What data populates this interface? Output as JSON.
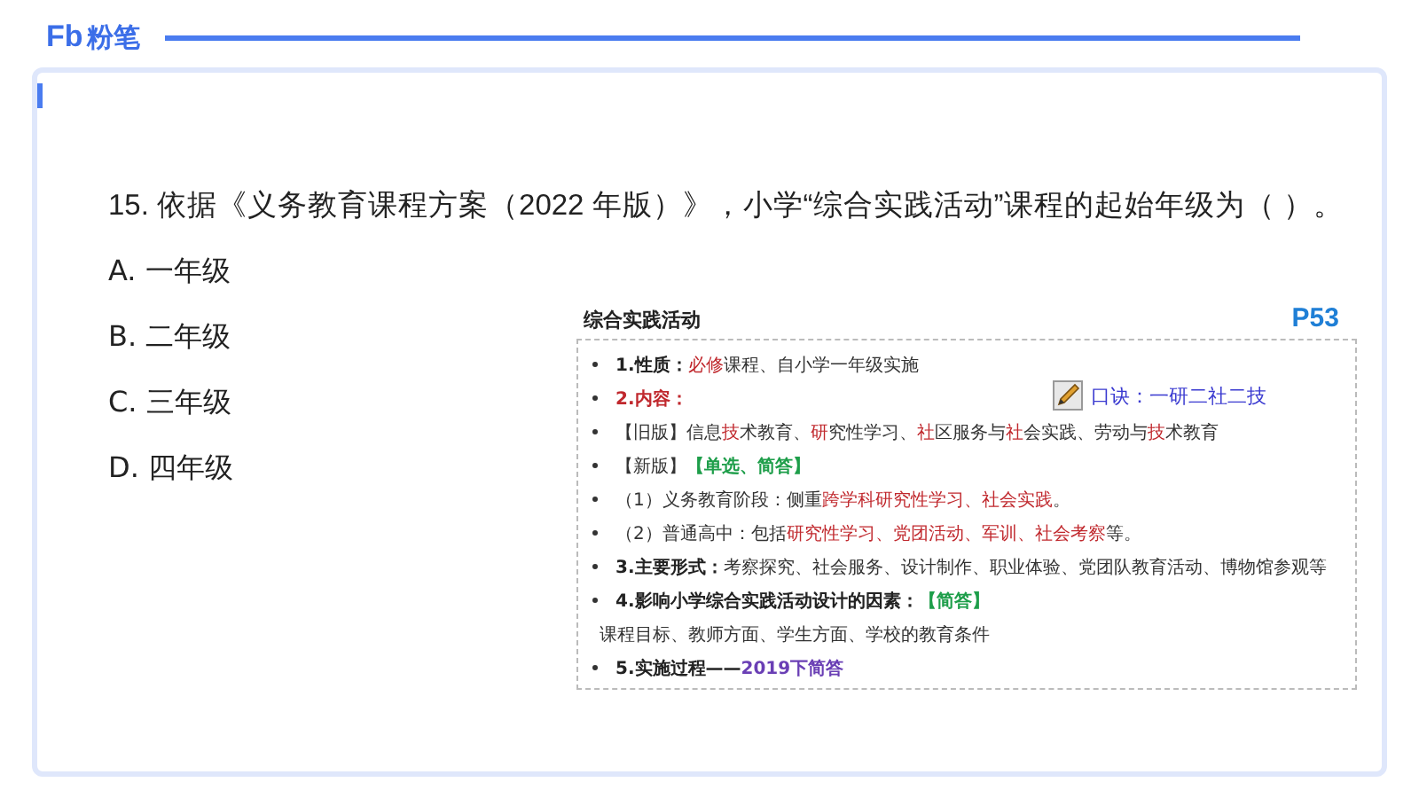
{
  "logo": {
    "mark": "Fb",
    "name": "粉笔"
  },
  "question": {
    "text": "15. 依据《义务教育课程方案（2022 年版）》，小学“综合实践活动”课程的起始年级为（ ）。",
    "options": [
      "A. 一年级",
      "B. 二年级",
      "C. 三年级",
      "D. 四年级"
    ]
  },
  "note": {
    "title": "综合实践活动",
    "page": "P53",
    "mnemonic": "口诀：一研二社二技",
    "lines": [
      {
        "bullet": true,
        "segments": [
          {
            "text": "1.性质：",
            "kind": "bold"
          },
          {
            "text": "必修",
            "kind": "red"
          },
          {
            "text": "课程、自小学一年级实施",
            "kind": "plain"
          }
        ]
      },
      {
        "bullet": true,
        "segments": [
          {
            "text": "2.内容：",
            "kind": "red-bold"
          }
        ]
      },
      {
        "bullet": true,
        "segments": [
          {
            "text": "【旧版】信息",
            "kind": "plain"
          },
          {
            "text": "技",
            "kind": "red"
          },
          {
            "text": "术教育、",
            "kind": "plain"
          },
          {
            "text": "研",
            "kind": "red"
          },
          {
            "text": "究性学习、",
            "kind": "plain"
          },
          {
            "text": "社",
            "kind": "red"
          },
          {
            "text": "区服务与",
            "kind": "plain"
          },
          {
            "text": "社",
            "kind": "red"
          },
          {
            "text": "会实践、劳动与",
            "kind": "plain"
          },
          {
            "text": "技",
            "kind": "red"
          },
          {
            "text": "术教育",
            "kind": "plain"
          }
        ]
      },
      {
        "bullet": true,
        "segments": [
          {
            "text": "【新版】",
            "kind": "plain"
          },
          {
            "text": "【单选、简答】",
            "kind": "green"
          }
        ]
      },
      {
        "bullet": true,
        "segments": [
          {
            "text": "（1）义务教育阶段：侧重",
            "kind": "plain"
          },
          {
            "text": "跨学科研究性学习、社会实践",
            "kind": "red"
          },
          {
            "text": "。",
            "kind": "plain"
          }
        ]
      },
      {
        "bullet": true,
        "segments": [
          {
            "text": "（2）普通高中：包括",
            "kind": "plain"
          },
          {
            "text": "研究性学习、党团活动、军训、社会考察",
            "kind": "red"
          },
          {
            "text": "等。",
            "kind": "plain"
          }
        ]
      },
      {
        "bullet": true,
        "segments": [
          {
            "text": "3.主要形式：",
            "kind": "bold"
          },
          {
            "text": "考察探究、社会服务、设计制作、职业体验、党团队教育活动、博物馆参观等",
            "kind": "plain"
          }
        ]
      },
      {
        "bullet": true,
        "segments": [
          {
            "text": "4.影响小学综合实践活动设计的因素：",
            "kind": "bold"
          },
          {
            "text": "【简答】",
            "kind": "green"
          }
        ]
      },
      {
        "bullet": false,
        "segments": [
          {
            "text": "课程目标、教师方面、学生方面、学校的教育条件",
            "kind": "plain"
          }
        ]
      },
      {
        "bullet": true,
        "segments": [
          {
            "text": "5.实施过程——",
            "kind": "bold"
          },
          {
            "text": "2019下简答",
            "kind": "purple"
          }
        ]
      }
    ]
  }
}
